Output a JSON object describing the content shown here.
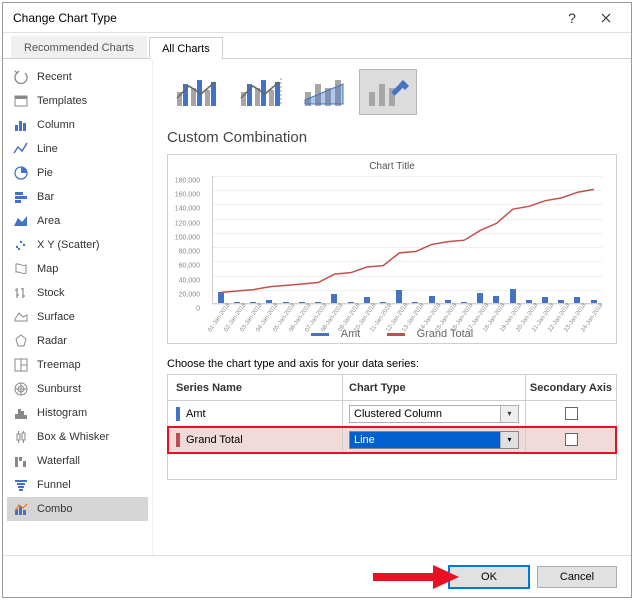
{
  "window": {
    "title": "Change Chart Type"
  },
  "tabs": {
    "recommended": "Recommended Charts",
    "all": "All Charts"
  },
  "sidebar": {
    "items": [
      {
        "label": "Recent"
      },
      {
        "label": "Templates"
      },
      {
        "label": "Column"
      },
      {
        "label": "Line"
      },
      {
        "label": "Pie"
      },
      {
        "label": "Bar"
      },
      {
        "label": "Area"
      },
      {
        "label": "X Y (Scatter)"
      },
      {
        "label": "Map"
      },
      {
        "label": "Stock"
      },
      {
        "label": "Surface"
      },
      {
        "label": "Radar"
      },
      {
        "label": "Treemap"
      },
      {
        "label": "Sunburst"
      },
      {
        "label": "Histogram"
      },
      {
        "label": "Box & Whisker"
      },
      {
        "label": "Waterfall"
      },
      {
        "label": "Funnel"
      },
      {
        "label": "Combo"
      }
    ]
  },
  "combo_subtype_section": {
    "title": "Custom Combination"
  },
  "preview": {
    "title": "Chart Title",
    "legend": {
      "s1": "Amt",
      "s2": "Grand Total",
      "c1": "#4472c4",
      "c2": "#c0504d"
    }
  },
  "chart_data": {
    "type": "combo",
    "title": "Chart Title",
    "xlabel": "",
    "ylabel": "",
    "ylim": [
      0,
      180000
    ],
    "yticks": [
      0,
      20000,
      40000,
      60000,
      80000,
      100000,
      120000,
      140000,
      160000,
      180000
    ],
    "categories": [
      "01-Jan-2018",
      "02-Jan-2018",
      "03-Jan-2018",
      "04-Jan-2018",
      "05-Jan-2018",
      "06-Jan-2018",
      "07-Jan-2018",
      "08-Jan-2018",
      "09-Jan-2018",
      "10-Jan-2018",
      "11-Jan-2018",
      "12-Jan-2018",
      "13-Jan-2018",
      "14-Jan-2018",
      "15-Jan-2018",
      "16-Jan-2018",
      "17-Jan-2018",
      "18-Jan-2018",
      "19-Jan-2018",
      "20-Jan-2018",
      "21-Jan-2018",
      "22-Jan-2018",
      "23-Jan-2018",
      "24-Jan-2018"
    ],
    "series": [
      {
        "name": "Amt",
        "type": "bar",
        "color": "#4472c4",
        "values": [
          15000,
          2000,
          2000,
          4000,
          2000,
          2000,
          2000,
          12000,
          2000,
          8000,
          2000,
          18000,
          2000,
          10000,
          4000,
          2000,
          14000,
          10000,
          20000,
          4000,
          8000,
          4000,
          8000,
          4000
        ]
      },
      {
        "name": "Grand Total",
        "type": "line",
        "color": "#c0504d",
        "values": [
          15000,
          17000,
          19000,
          23000,
          25000,
          27000,
          29000,
          41000,
          43000,
          51000,
          53000,
          71000,
          73000,
          83000,
          87000,
          89000,
          103000,
          113000,
          133000,
          137000,
          145000,
          149000,
          157000,
          161000
        ]
      }
    ]
  },
  "series_panel": {
    "instruction": "Choose the chart type and axis for your data series:",
    "headers": {
      "name": "Series Name",
      "type": "Chart Type",
      "secondary": "Secondary Axis"
    },
    "rows": [
      {
        "name": "Amt",
        "type": "Clustered Column",
        "color": "#4472c4",
        "secondary": false
      },
      {
        "name": "Grand Total",
        "type": "Line",
        "color": "#c0504d",
        "secondary": false
      }
    ]
  },
  "buttons": {
    "ok": "OK",
    "cancel": "Cancel"
  }
}
